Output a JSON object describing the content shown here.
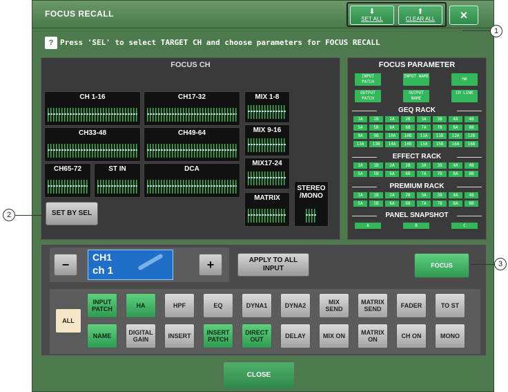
{
  "window": {
    "title": "FOCUS RECALL",
    "set_all_label": "SET ALL",
    "clear_all_label": "CLEAR ALL",
    "close_icon": "×",
    "hint": "Press 'SEL' to select TARGET CH and choose parameters for FOCUS RECALL",
    "hint_icon": "?"
  },
  "focus_ch": {
    "title": "FOCUS CH",
    "groups": [
      "CH 1-16",
      "CH17-32",
      "CH33-48",
      "CH49-64",
      "CH65-72",
      "ST IN",
      "DCA",
      "MIX 1-8",
      "MIX 9-16",
      "MIX17-24",
      "MATRIX",
      "STEREO /MONO"
    ],
    "set_by_sel": "SET BY SEL"
  },
  "focus_parameter": {
    "title": "FOCUS PARAMETER",
    "top_buttons": [
      "INPUT PATCH",
      "INPUT NAME",
      "HA",
      "OUTPUT PATCH",
      "OUTPUT NAME",
      "CH LINK"
    ],
    "geq_title": "GEQ RACK",
    "geq_cells": [
      "1A",
      "1B",
      "2A",
      "2B",
      "3A",
      "3B",
      "4A",
      "4B",
      "5A",
      "5B",
      "6A",
      "6B",
      "7A",
      "7B",
      "8A",
      "8B",
      "9A",
      "9B",
      "10A",
      "10B",
      "11A",
      "11B",
      "12A",
      "12B",
      "13A",
      "13B",
      "14A",
      "14B",
      "15A",
      "15B",
      "16A",
      "16B"
    ],
    "effect_title": "EFFECT RACK",
    "effect_cells": [
      "1A",
      "1B",
      "2A",
      "2B",
      "3A",
      "3B",
      "4A",
      "4B",
      "5A",
      "5B",
      "6A",
      "6B",
      "7A",
      "7B",
      "8A",
      "8B"
    ],
    "premium_title": "PREMIUM RACK",
    "premium_cells": [
      "1A",
      "1B",
      "2A",
      "2B",
      "3A",
      "3B",
      "4A",
      "4B",
      "5A",
      "5B",
      "6A",
      "6B",
      "7A",
      "7B",
      "8A",
      "8B"
    ],
    "snapshot_title": "PANEL SNAPSHOT",
    "snapshot_cells": [
      "A",
      "B",
      "C"
    ]
  },
  "channel": {
    "minus": "−",
    "plus": "+",
    "line1": "CH1",
    "line2": "ch 1",
    "apply_to_all": "APPLY TO ALL INPUT",
    "focus": "FOCUS"
  },
  "params": {
    "all": "ALL",
    "row1": [
      "INPUT PATCH",
      "HA",
      "HPF",
      "EQ",
      "DYNA1",
      "DYNA2",
      "MIX SEND",
      "MATRIX SEND",
      "FADER",
      "TO ST"
    ],
    "row2": [
      "NAME",
      "DIGITAL GAIN",
      "INSERT",
      "INSERT PATCH",
      "DIRECT OUT",
      "DELAY",
      "MIX ON",
      "MATRIX ON",
      "CH ON",
      "MONO"
    ],
    "row1_on": [
      true,
      true,
      false,
      false,
      false,
      false,
      false,
      false,
      false,
      false
    ],
    "row2_on": [
      true,
      false,
      false,
      true,
      true,
      false,
      false,
      false,
      false,
      false
    ]
  },
  "close_button": "CLOSE",
  "callouts": [
    "1",
    "2",
    "3"
  ],
  "colors": {
    "panel_green": "#4d7a4d",
    "active_green": "#34b65a",
    "ch_blue": "#1f6fc9"
  }
}
